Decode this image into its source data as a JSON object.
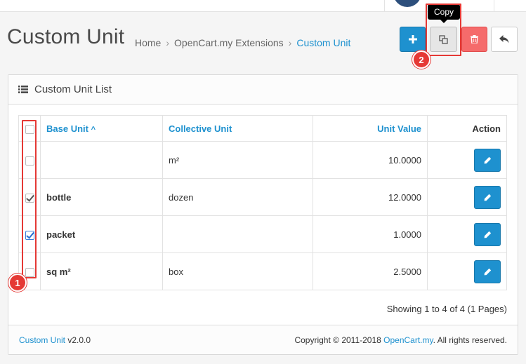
{
  "header": {
    "page_title": "Custom Unit",
    "breadcrumb": [
      {
        "label": "Home"
      },
      {
        "label": "OpenCart.my Extensions"
      },
      {
        "label": "Custom Unit"
      }
    ],
    "separator": "›",
    "tooltip": "Copy",
    "buttons": {
      "add": "plus-icon",
      "copy": "copy-icon",
      "delete": "trash-icon",
      "back": "reply-icon"
    }
  },
  "annotations": {
    "marker_1": "1",
    "marker_2": "2"
  },
  "panel": {
    "title": "Custom Unit List",
    "table": {
      "headers": {
        "base_unit": "Base Unit",
        "collective_unit": "Collective Unit",
        "unit_value": "Unit Value",
        "action": "Action"
      },
      "sort_indicator": "^",
      "rows": [
        {
          "base_unit": "",
          "collective_unit": "m²",
          "unit_value": "10.0000",
          "checked": false
        },
        {
          "base_unit": "bottle",
          "collective_unit": "dozen",
          "unit_value": "12.0000",
          "checked": true
        },
        {
          "base_unit": "packet",
          "collective_unit": "",
          "unit_value": "1.0000",
          "checked": true
        },
        {
          "base_unit": "sq m²",
          "collective_unit": "box",
          "unit_value": "2.5000",
          "checked": false
        }
      ]
    },
    "pagination": "Showing 1 to 4 of 4 (1 Pages)"
  },
  "footer": {
    "module_link": "Custom Unit",
    "version": " v2.0.0",
    "copyright_prefix": "Copyright © 2011-2018 ",
    "company_link": "OpenCart.my",
    "copyright_suffix": ". All rights reserved."
  },
  "colors": {
    "primary": "#1e91cf",
    "danger": "#f56b6b",
    "highlight": "#e53935"
  }
}
